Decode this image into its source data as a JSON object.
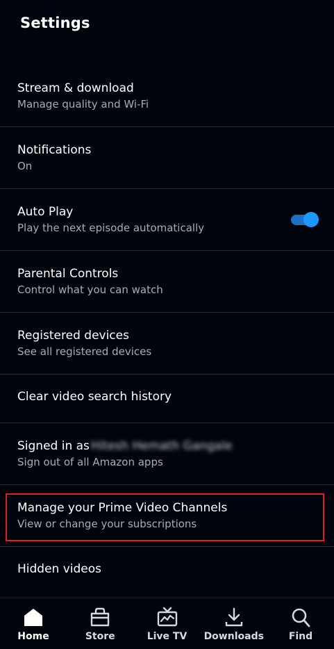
{
  "header": {
    "title": "Settings"
  },
  "settings": [
    {
      "label": "Stream & download",
      "sub": "Manage quality and Wi-Fi"
    },
    {
      "label": "Notifications",
      "sub": "On"
    },
    {
      "label": "Auto Play",
      "sub": "Play the next episode automatically",
      "toggle_on": true
    },
    {
      "label": "Parental Controls",
      "sub": "Control what you can watch"
    },
    {
      "label": "Registered devices",
      "sub": "See all registered devices"
    },
    {
      "label": "Clear video search history"
    },
    {
      "label": "Signed in as",
      "sub": "Sign out of all Amazon apps"
    },
    {
      "label": "Manage your Prime Video Channels",
      "sub": "View or change your subscriptions"
    },
    {
      "label": "Hidden videos"
    }
  ],
  "nav": [
    {
      "label": "Home",
      "icon": "home-icon",
      "active": true
    },
    {
      "label": "Store",
      "icon": "store-icon"
    },
    {
      "label": "Live TV",
      "icon": "live-tv-icon"
    },
    {
      "label": "Downloads",
      "icon": "downloads-icon"
    },
    {
      "label": "Find",
      "icon": "search-icon"
    }
  ],
  "colors": {
    "background": "#00050d",
    "toggle_accent": "#1a98ff",
    "highlight_border": "#e21d25"
  }
}
